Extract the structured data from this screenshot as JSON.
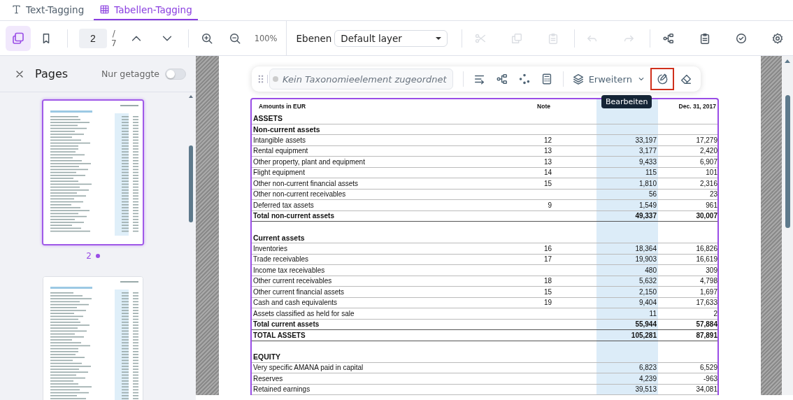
{
  "tabs": [
    {
      "label": "Text-Tagging",
      "selected": false
    },
    {
      "label": "Tabellen-Tagging",
      "selected": true
    }
  ],
  "toolbar": {
    "tools_left": [
      {
        "selected": true
      },
      {
        "selected": false
      }
    ],
    "page_input": "2",
    "page_separator": "/",
    "page_count": "7",
    "zoom": "100%",
    "layer_label": "Ebenen",
    "layer_value": "Default layer",
    "tools_right": [
      {
        "disabled": true
      },
      {
        "disabled": true
      },
      {
        "disabled": true
      },
      {
        "disabled": true
      },
      {
        "disabled": true
      },
      {
        "disabled": false
      },
      {
        "disabled": false
      },
      {
        "disabled": false
      },
      {
        "disabled": false
      }
    ]
  },
  "pages_panel": {
    "title": "Pages",
    "filter_label": "Nur getaggte",
    "filter_on": false,
    "thumbnails": [
      {
        "page": "2",
        "selected": true,
        "tagged": true
      },
      {
        "selected": false
      }
    ]
  },
  "floating_toolbar": {
    "concept_placeholder": "Kein Taxonomieelement zugeordnet",
    "expand_label": "Erweitern",
    "tooltip": "Bearbeiten",
    "tools": [
      {
        "outlined": false
      },
      {
        "outlined": false
      },
      {
        "outlined": false
      },
      {
        "outlined": false
      },
      {
        "outlined": true
      },
      {
        "outlined": false
      }
    ]
  },
  "table": {
    "columns": [
      {
        "label": "Amounts in EUR",
        "selected": false
      },
      {
        "label": "Note",
        "selected": false
      },
      {
        "selected": true
      },
      {
        "label": "Dec. 31, 2017",
        "selected": false
      }
    ],
    "rows": [
      {
        "kind": "section",
        "label": "ASSETS"
      },
      {
        "kind": "section",
        "label": "Non-current assets"
      },
      {
        "kind": "item",
        "label": "Intangible assets",
        "note": "12",
        "value_1": "33,197",
        "value_2": "17,279"
      },
      {
        "kind": "item",
        "label": "Rental equipment",
        "note": "13",
        "value_1": "3,177",
        "value_2": "2,420"
      },
      {
        "kind": "item",
        "label": "Other property, plant and equipment",
        "note": "13",
        "value_1": "9,433",
        "value_2": "6,907"
      },
      {
        "kind": "item",
        "label": "Flight equipment",
        "note": "14",
        "value_1": "115",
        "value_2": "101"
      },
      {
        "kind": "item",
        "label": "Other non-current financial assets",
        "note": "15",
        "value_1": "1,810",
        "value_2": "2,316"
      },
      {
        "kind": "item",
        "label": "Other non-current receivables",
        "value_1": "56",
        "value_2": "23"
      },
      {
        "kind": "item",
        "label": "Deferred tax assets",
        "note": "9",
        "value_1": "1,549",
        "value_2": "961"
      },
      {
        "kind": "total",
        "label": "Total non-current assets",
        "value_1": "49,337",
        "value_2": "30,007"
      },
      {
        "kind": "spacer"
      },
      {
        "kind": "section",
        "label": "Current assets"
      },
      {
        "kind": "item",
        "label": "Inventories",
        "note": "16",
        "value_1": "18,364",
        "value_2": "16,826"
      },
      {
        "kind": "item",
        "label": "Trade receivables",
        "note": "17",
        "value_1": "19,903",
        "value_2": "16,619"
      },
      {
        "kind": "item",
        "label": "Income tax receivables",
        "value_1": "480",
        "value_2": "309"
      },
      {
        "kind": "item",
        "label": "Other current receivables",
        "note": "18",
        "value_1": "5,632",
        "value_2": "4,798"
      },
      {
        "kind": "item",
        "label": "Other current financial assets",
        "note": "15",
        "value_1": "2,150",
        "value_2": "1,697"
      },
      {
        "kind": "item",
        "label": "Cash and cash equivalents",
        "note": "19",
        "value_1": "9,404",
        "value_2": "17,633"
      },
      {
        "kind": "item",
        "label": "Assets classified as held for sale",
        "value_1": "11",
        "value_2": "2"
      },
      {
        "kind": "total",
        "label": "Total current assets",
        "value_1": "55,944",
        "value_2": "57,884"
      },
      {
        "kind": "total",
        "label": "TOTAL ASSETS",
        "value_1": "105,281",
        "value_2": "87,891"
      },
      {
        "kind": "spacer"
      },
      {
        "kind": "section",
        "label": "EQUITY"
      },
      {
        "kind": "item",
        "label": "Very specific AMANA paid in capital",
        "value_1": "6,823",
        "value_2": "6,529"
      },
      {
        "kind": "item",
        "label": "Reserves",
        "value_1": "4,239",
        "value_2": "-963"
      },
      {
        "kind": "item",
        "label": "Retained earnings",
        "value_1": "39,513",
        "value_2": "34,081"
      }
    ]
  }
}
